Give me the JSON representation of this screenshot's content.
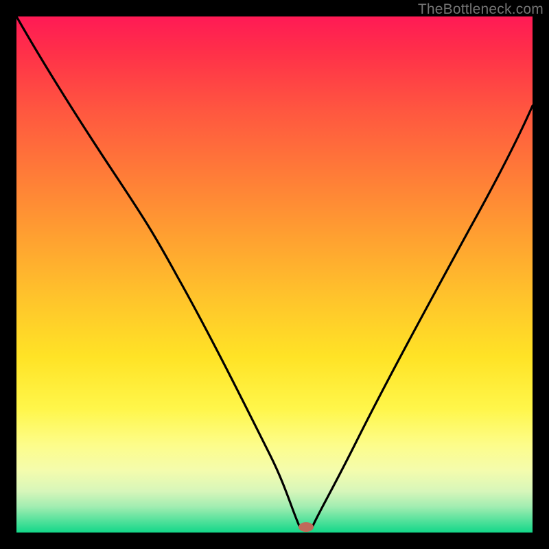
{
  "watermark": "TheBottleneck.com",
  "chart_data": {
    "type": "line",
    "title": "",
    "xlabel": "",
    "ylabel": "",
    "xlim": [
      0,
      100
    ],
    "ylim": [
      0,
      100
    ],
    "grid": false,
    "legend": false,
    "series": [
      {
        "name": "bottleneck-curve",
        "x": [
          0,
          8,
          16,
          24,
          29,
          36,
          44,
          50,
          53,
          55,
          57,
          60,
          66,
          74,
          82,
          90,
          100
        ],
        "values": [
          100,
          88,
          75,
          62,
          54,
          42,
          28,
          15,
          6,
          1,
          1,
          4,
          14,
          30,
          47,
          62,
          83
        ]
      }
    ],
    "marker": {
      "x": 56,
      "y": 0,
      "color": "#c06a5a"
    },
    "gradient_stops": [
      {
        "pos": 0,
        "color": "#ff1a55"
      },
      {
        "pos": 0.5,
        "color": "#ffc52b"
      },
      {
        "pos": 0.8,
        "color": "#fdfd8a"
      },
      {
        "pos": 1.0,
        "color": "#13d789"
      }
    ]
  }
}
